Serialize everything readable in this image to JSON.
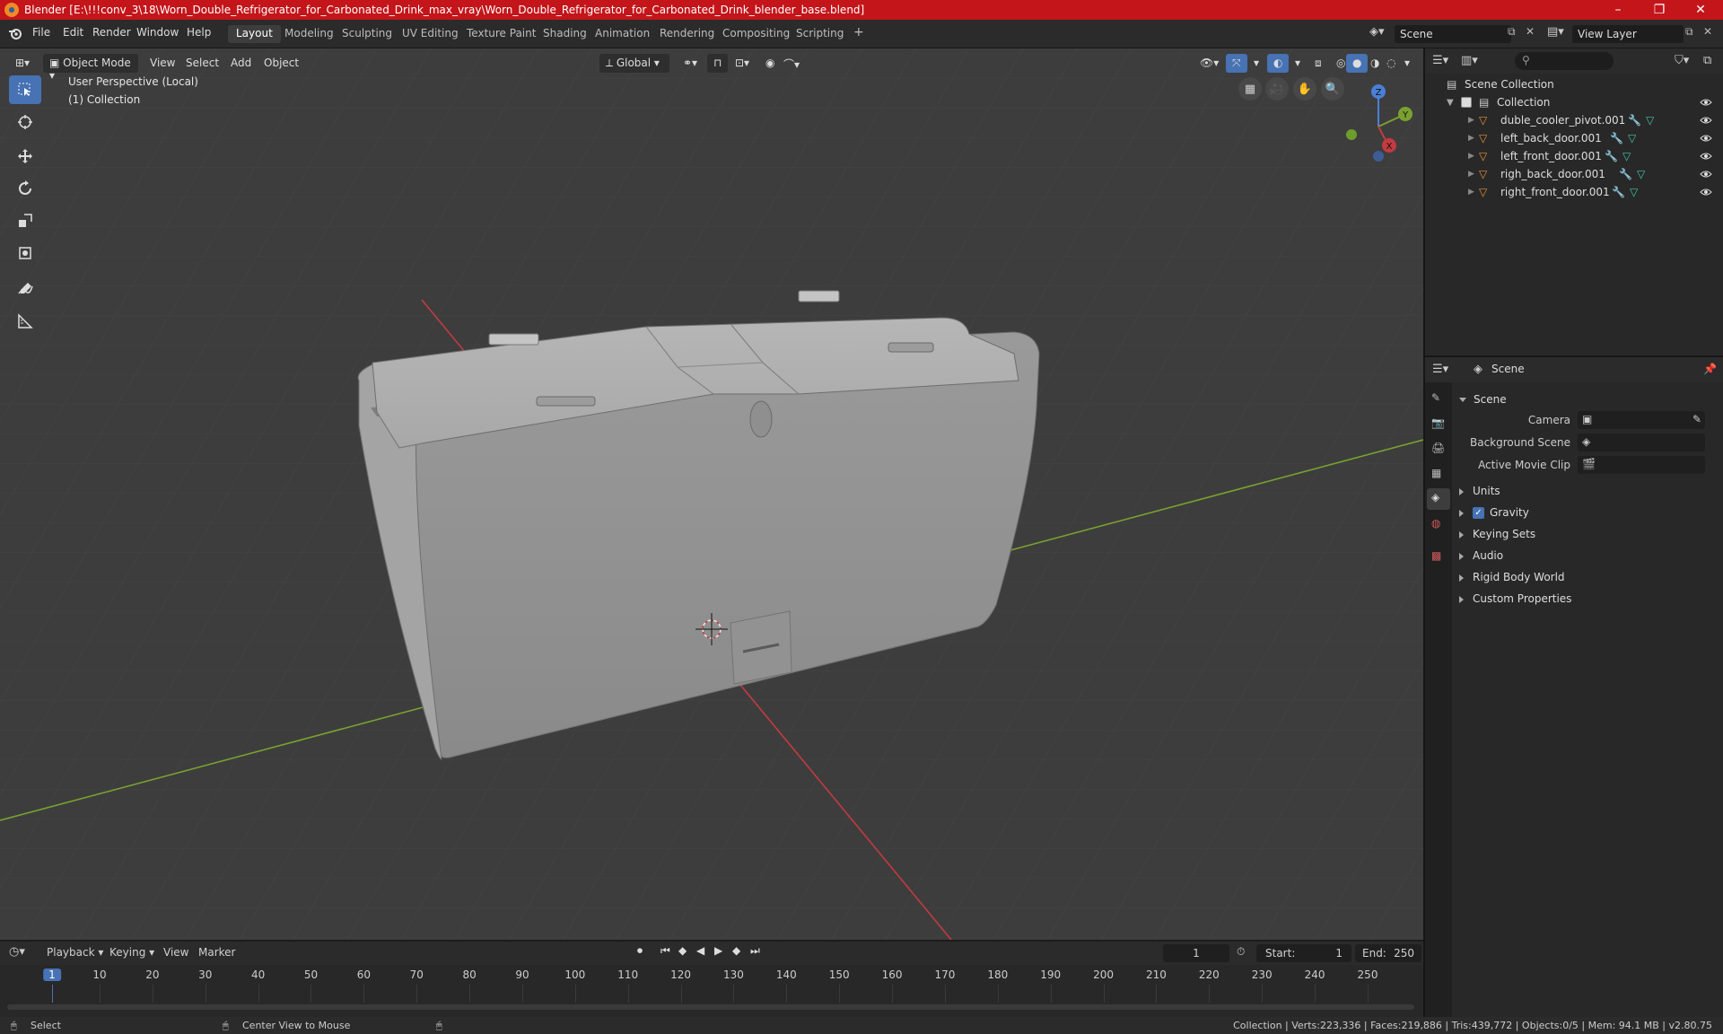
{
  "window": {
    "title": "Blender [E:\\!!!conv_3\\18\\Worn_Double_Refrigerator_for_Carbonated_Drink_max_vray\\Worn_Double_Refrigerator_for_Carbonated_Drink_blender_base.blend]",
    "controls": [
      "–",
      "❐",
      "✕"
    ]
  },
  "menu": [
    "File",
    "Edit",
    "Render",
    "Window",
    "Help"
  ],
  "workspaces": [
    {
      "label": "Layout",
      "active": true
    },
    {
      "label": "Modeling"
    },
    {
      "label": "Sculpting"
    },
    {
      "label": "UV Editing"
    },
    {
      "label": "Texture Paint"
    },
    {
      "label": "Shading"
    },
    {
      "label": "Animation"
    },
    {
      "label": "Rendering"
    },
    {
      "label": "Compositing"
    },
    {
      "label": "Scripting"
    }
  ],
  "add_workspace": "+",
  "scene_field": "Scene",
  "view_layer_field": "View Layer",
  "viewport": {
    "mode": "Object Mode",
    "menus": [
      "View",
      "Select",
      "Add",
      "Object"
    ],
    "transform_orientation": "Global",
    "overlay_line1": "User Perspective (Local)",
    "overlay_line2": "(1) Collection",
    "axes": {
      "z": "Z",
      "y": "Y",
      "x": "X"
    }
  },
  "outliner": {
    "search_placeholder": "",
    "root": "Scene Collection",
    "collection": "Collection",
    "objects": [
      "duble_cooler_pivot.001",
      "left_back_door.001",
      "left_front_door.001",
      "righ_back_door.001",
      "right_front_door.001"
    ]
  },
  "properties": {
    "header": "Scene",
    "section": "Scene",
    "camera_label": "Camera",
    "background_scene_label": "Background Scene",
    "active_movie_clip_label": "Active Movie Clip",
    "panels": [
      "Units",
      "Gravity",
      "Keying Sets",
      "Audio",
      "Rigid Body World",
      "Custom Properties"
    ]
  },
  "timeline": {
    "menus": [
      "Playback",
      "Keying",
      "View",
      "Marker"
    ],
    "current_frame": "1",
    "start_label": "Start:",
    "start": "1",
    "end_label": "End:",
    "end": "250",
    "ticks": [
      1,
      10,
      20,
      30,
      40,
      50,
      60,
      70,
      80,
      90,
      100,
      110,
      120,
      130,
      140,
      150,
      160,
      170,
      180,
      190,
      200,
      210,
      220,
      230,
      240,
      250
    ]
  },
  "status": {
    "left": "Select",
    "middle": "Center View to Mouse",
    "right": "Collection | Verts:223,336 | Faces:219,886 | Tris:439,772 | Objects:0/5 | Mem: 94.1 MB | v2.80.75"
  },
  "colors": {
    "titlebar": "#c3151a",
    "accent": "#4772b3",
    "viewport_bg": "#3d3d3d",
    "axis_x": "#c23b40",
    "axis_y": "#7aa12f",
    "object_orange": "#e8913a"
  }
}
